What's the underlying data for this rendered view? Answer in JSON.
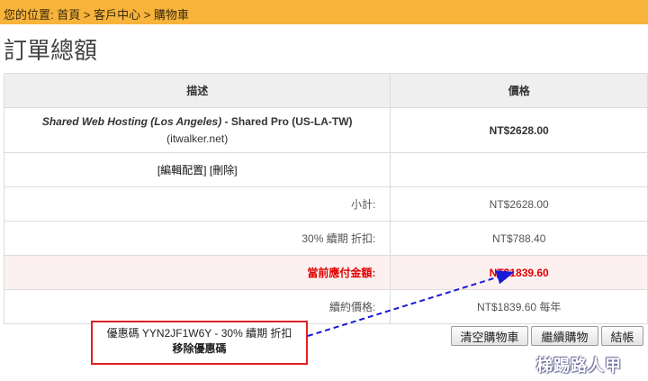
{
  "breadcrumb": {
    "prefix": "您的位置: ",
    "home": "首頁",
    "sep1": " > ",
    "client_area": "客戶中心",
    "sep2": " > ",
    "cart": "購物車"
  },
  "page_title": "訂單總額",
  "table": {
    "headers": {
      "description": "描述",
      "price": "價格"
    },
    "item": {
      "product": "Shared Web Hosting (Los Angeles)",
      "separator": " - ",
      "plan": "Shared Pro (US-LA-TW)",
      "domain": " (itwalker.net)",
      "price": "NT$2628.00"
    },
    "actions": {
      "edit": "[編輯配置]",
      "remove": "[刪除]"
    },
    "subtotal": {
      "label": "小計:",
      "value": "NT$2628.00"
    },
    "discount": {
      "label": "30% 續期 折扣:",
      "value": "NT$788.40"
    },
    "total_due": {
      "label": "當前應付金額:",
      "value": "NT$1839.60"
    },
    "renewal": {
      "label": "續約價格:",
      "value": "NT$1839.60 每年"
    }
  },
  "promo": {
    "text": "優惠碼 YYN2JF1W6Y - 30% 續期 折扣",
    "remove_label": "移除優惠碼"
  },
  "buttons": {
    "empty_cart": "清空購物車",
    "continue_shopping": "繼續購物",
    "checkout": "結帳"
  },
  "watermark": "梯踢路人甲",
  "colors": {
    "breadcrumb_bar": "#f7b33a",
    "total_text": "#e00000",
    "annotation_box": "#e02020",
    "annotation_arrow": "#1a1ad6"
  }
}
